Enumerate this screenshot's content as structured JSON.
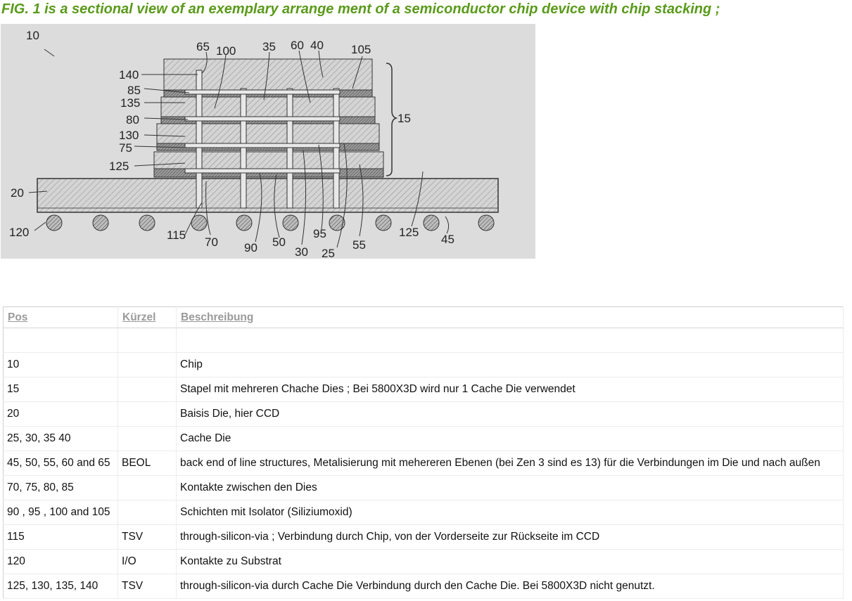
{
  "caption": "FIG. 1 is a sectional view of an exemplary arrange ment of a semiconductor chip device with chip stacking ;",
  "figure": {
    "reference_labels": [
      "10",
      "65",
      "100",
      "35",
      "60",
      "40",
      "105",
      "140",
      "85",
      "135",
      "80",
      "130",
      "75",
      "125",
      "15",
      "20",
      "120",
      "115",
      "70",
      "90",
      "50",
      "30",
      "95",
      "25",
      "55",
      "125",
      "45"
    ]
  },
  "table": {
    "headers": {
      "pos": "Pos",
      "kuerzel": "Kürzel",
      "beschreibung": "Beschreibung"
    },
    "rows": [
      {
        "pos": "10",
        "kuerzel": "",
        "beschreibung": "Chip"
      },
      {
        "pos": "15",
        "kuerzel": "",
        "beschreibung": "Stapel mit mehreren Chache Dies ; Bei 5800X3D wird nur 1 Cache Die verwendet"
      },
      {
        "pos": "20",
        "kuerzel": "",
        "beschreibung": "Baisis Die, hier CCD"
      },
      {
        "pos": "25, 30, 35  40",
        "kuerzel": "",
        "beschreibung": "Cache Die"
      },
      {
        "pos": "45, 50, 55, 60 and 65",
        "kuerzel": "BEOL",
        "beschreibung": "back end of line structures, Metalisierung mit mehereren Ebenen (bei Zen 3 sind es 13) für die Verbindungen im Die und nach außen"
      },
      {
        "pos": "70, 75, 80, 85",
        "kuerzel": "",
        "beschreibung": "Kontakte zwischen den Dies"
      },
      {
        "pos": "90 , 95 , 100 and 105",
        "kuerzel": "",
        "beschreibung": "Schichten mit Isolator (Siliziumoxid)"
      },
      {
        "pos": "115",
        "kuerzel": "TSV",
        "beschreibung": "through-silicon-via ; Verbindung durch Chip, von der Vorderseite zur Rückseite im CCD"
      },
      {
        "pos": "120",
        "kuerzel": "I/O",
        "beschreibung": "Kontakte zu Substrat"
      },
      {
        "pos": "125, 130, 135, 140",
        "kuerzel": "TSV",
        "beschreibung": "through-silicon-via durch Cache Die Verbindung durch den Cache Die. Bei 5800X3D nicht genutzt."
      }
    ]
  }
}
